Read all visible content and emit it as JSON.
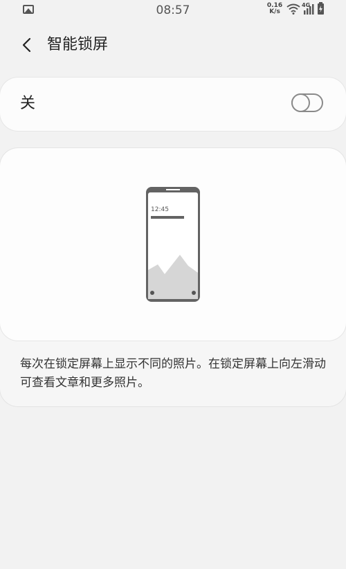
{
  "status_bar": {
    "time": "08:57",
    "net_speed_value": "0.16",
    "net_speed_unit": "K/s",
    "network_type": "4G",
    "icons": [
      "gallery-icon",
      "wifi-icon",
      "signal-icon",
      "battery-charging-icon"
    ]
  },
  "header": {
    "back_icon": "chevron-left-icon",
    "title": "智能锁屏"
  },
  "toggle": {
    "label": "关",
    "state": "off"
  },
  "illustration": {
    "phone_time": "12:45",
    "icon": "lock-screen-phone-illustration"
  },
  "description": "每次在锁定屏幕上显示不同的照片。在锁定屏幕上向左滑动可查看文章和更多照片。",
  "colors": {
    "background": "#f2f2f2",
    "card": "#fcfcfc",
    "text": "#222222",
    "switch_off": "#8a8a8a"
  }
}
